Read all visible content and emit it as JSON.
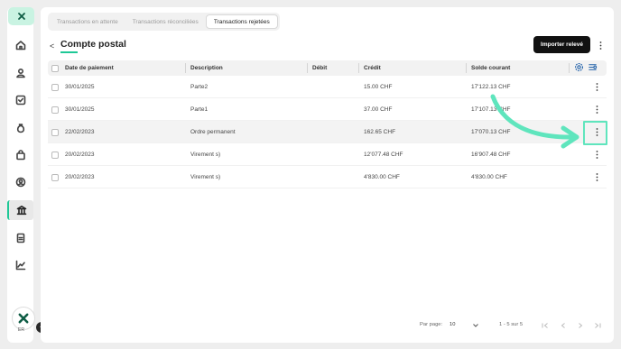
{
  "sidebar": {
    "logo_icon": "brand-logo-icon",
    "items": [
      {
        "name": "home",
        "icon": "home-icon",
        "active": false
      },
      {
        "name": "contacts",
        "icon": "contacts-icon",
        "active": false
      },
      {
        "name": "tasks",
        "icon": "checkbox-icon",
        "active": false
      },
      {
        "name": "finance",
        "icon": "money-bag-icon",
        "active": false
      },
      {
        "name": "shop",
        "icon": "shopping-bag-icon",
        "active": false
      },
      {
        "name": "support",
        "icon": "support-icon",
        "active": false
      },
      {
        "name": "bank",
        "icon": "bank-icon",
        "active": true
      },
      {
        "name": "documents",
        "icon": "document-icon",
        "active": false
      },
      {
        "name": "reports",
        "icon": "chart-icon",
        "active": false
      }
    ],
    "avatar_initials": "ER",
    "notification_count": "4"
  },
  "tabs": [
    {
      "label": "Transactions en attente",
      "active": false
    },
    {
      "label": "Transactions réconciliées",
      "active": false
    },
    {
      "label": "Transactions rejetées",
      "active": true
    }
  ],
  "header": {
    "back_glyph": "<",
    "title": "Compte postal",
    "import_button": "Importer relevé"
  },
  "table": {
    "columns": [
      "Date de paiement",
      "Description",
      "Débit",
      "Crédit",
      "Solde courant"
    ],
    "rows": [
      {
        "date": "30/01/2025",
        "description": "Parte2",
        "debit": "",
        "credit": "15.00 CHF",
        "balance": "17'122.13 CHF"
      },
      {
        "date": "30/01/2025",
        "description": "Parte1",
        "debit": "",
        "credit": "37.00 CHF",
        "balance": "17'107.13 CHF"
      },
      {
        "date": "22/02/2023",
        "description": "Ordre permanent",
        "debit": "",
        "credit": "162.65 CHF",
        "balance": "17'070.13 CHF"
      },
      {
        "date": "20/02/2023",
        "description": "Virement s)",
        "debit": "",
        "credit": "12'077.48 CHF",
        "balance": "16'907.48 CHF"
      },
      {
        "date": "20/02/2023",
        "description": "Virement s)",
        "debit": "",
        "credit": "4'830.00 CHF",
        "balance": "4'830.00 CHF"
      }
    ]
  },
  "pagination": {
    "per_page_label": "Par page:",
    "per_page_value": "10",
    "range_text": "1 - 5 sur 5"
  },
  "colors": {
    "accent": "#1ec896",
    "annotation": "#5fe5bd",
    "button_bg": "#111111"
  }
}
